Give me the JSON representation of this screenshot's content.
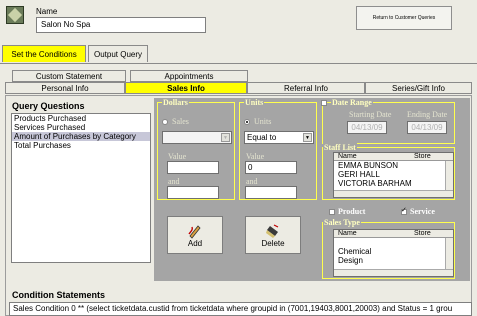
{
  "header": {
    "name_label": "Name",
    "name_value": "Salon No Spa",
    "return_button": "Return to Customer Queries"
  },
  "main_tabs": [
    {
      "label": "Set the Conditions",
      "active": true
    },
    {
      "label": "Output Query",
      "active": false
    }
  ],
  "sub_tabs_row1": [
    {
      "label": "Custom Statement"
    },
    {
      "label": "Appointments"
    }
  ],
  "sub_tabs_row2": [
    {
      "label": "Personal Info",
      "active": false
    },
    {
      "label": "Sales Info",
      "active": true
    },
    {
      "label": "Referral Info",
      "active": false
    },
    {
      "label": "Series/Gift Info",
      "active": false
    }
  ],
  "query_questions": {
    "title": "Query Questions",
    "items": [
      {
        "label": "Products Purchased",
        "selected": false
      },
      {
        "label": "Services Purchased",
        "selected": false
      },
      {
        "label": "Amount of Purchases by Category",
        "selected": true
      },
      {
        "label": "Total Purchases",
        "selected": false
      }
    ]
  },
  "dollars": {
    "title": "Dollars",
    "radio_label": "Sales",
    "value_label": "Value",
    "and_label": "and"
  },
  "units": {
    "title": "Units",
    "radio_label": "Units",
    "operator": "Equal to",
    "value_label": "Value",
    "value": "0",
    "and_label": "and"
  },
  "date_range": {
    "title": "Date Range",
    "starting_label": "Starting Date",
    "ending_label": "Ending Date",
    "starting_value": "04/13/09",
    "ending_value": "04/13/09"
  },
  "staff_list": {
    "title": "Staff List",
    "col_name": "Name",
    "col_store": "Store",
    "rows": [
      "EMMA BUNSON",
      "GERI HALL",
      "VICTORIA BARHAM"
    ]
  },
  "product_checkbox": {
    "label": "Product",
    "checked": false
  },
  "service_checkbox": {
    "label": "Service",
    "checked": true
  },
  "sales_type": {
    "title": "Sales Type",
    "col_name": "Name",
    "col_store": "Store",
    "rows": [
      "",
      "Chemical",
      "Design"
    ]
  },
  "buttons": {
    "add": "Add",
    "delete": "Delete"
  },
  "condition_statements": {
    "title": "Condition Statements",
    "text": "Sales Condition 0 ** (select ticketdata.custid from ticketdata where  groupid in (7001,19403,8001,20003) and Status = 1 grou"
  }
}
